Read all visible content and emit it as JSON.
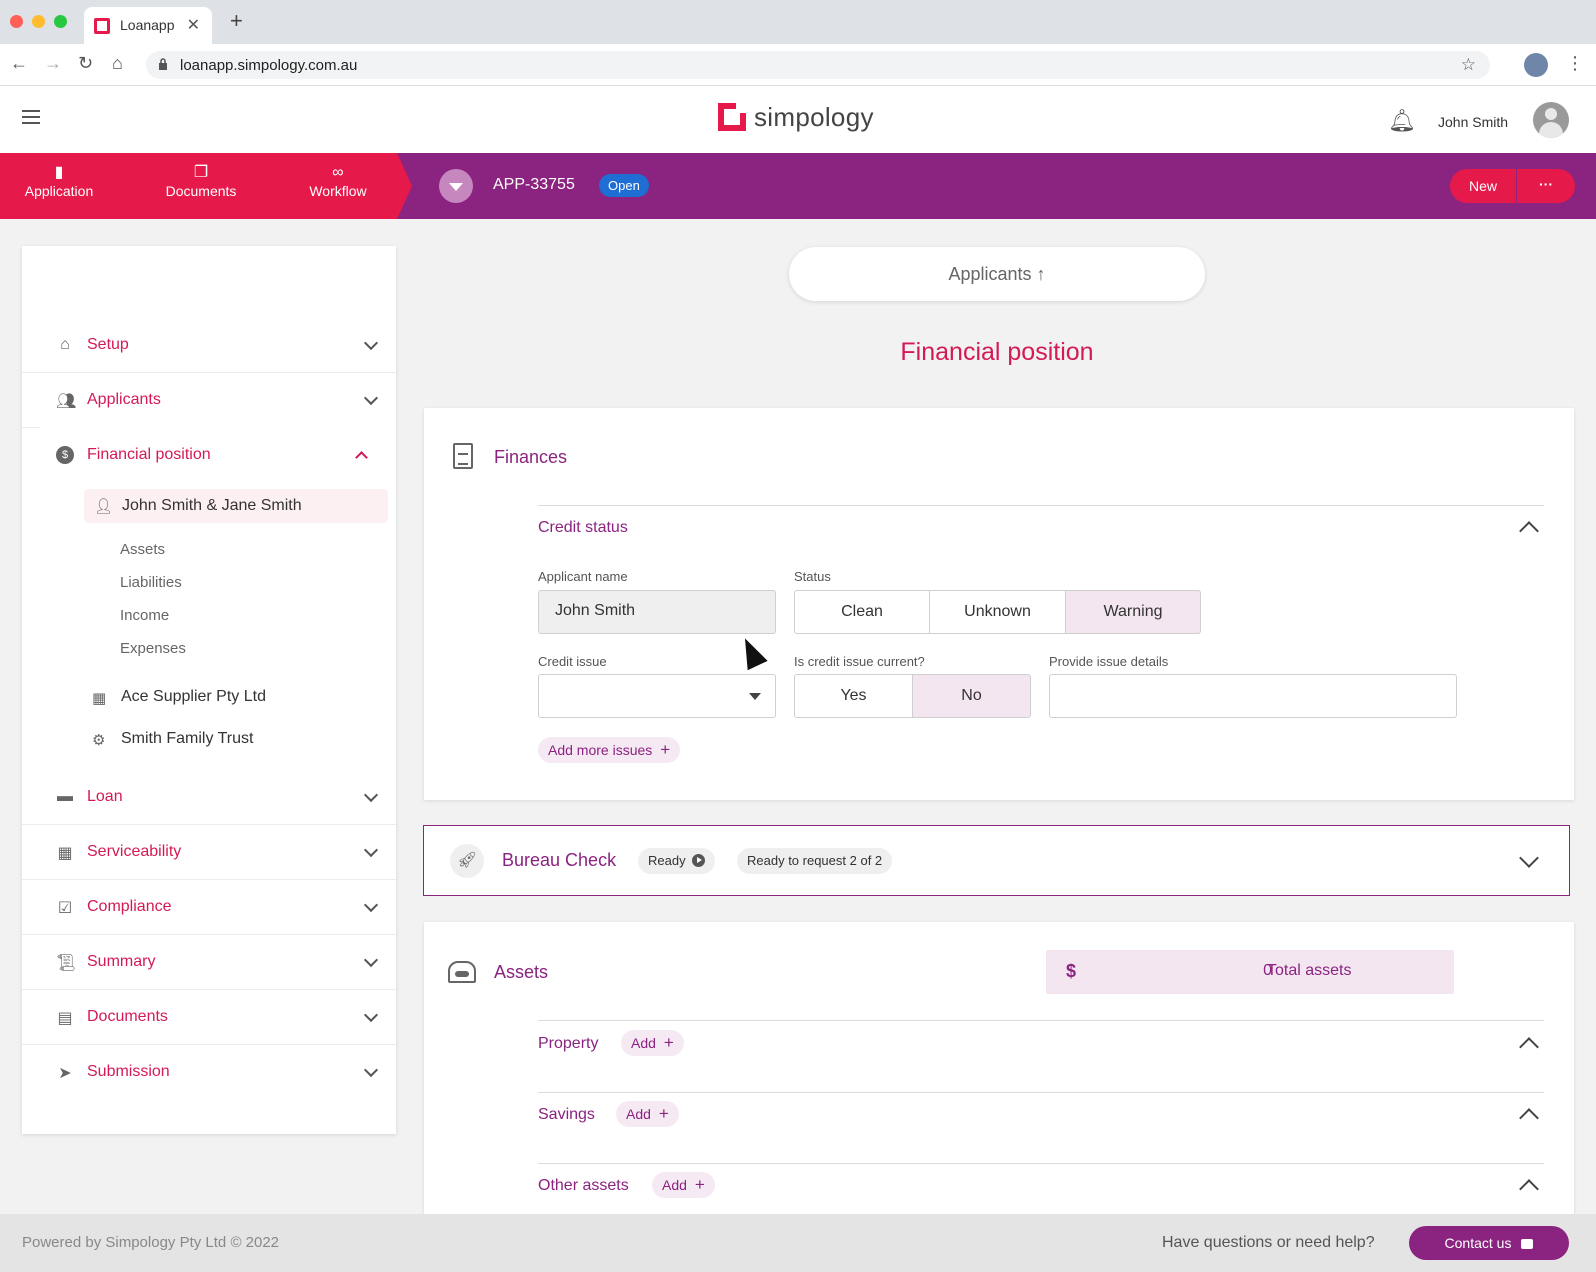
{
  "browser": {
    "tab_title": "Loanapp",
    "tab_close": "✕",
    "new_tab": "+",
    "url": "loanapp.simpology.com.au",
    "traffic_colors": [
      "#ff5f57",
      "#febc2e",
      "#28c840"
    ]
  },
  "header": {
    "logo_text": "simpology",
    "user_name": "John Smith"
  },
  "navbar": {
    "items": [
      {
        "label": "Application",
        "icon": "clipboard-icon"
      },
      {
        "label": "Documents",
        "icon": "copy-icon"
      },
      {
        "label": "Workflow",
        "icon": "infinity-icon"
      }
    ],
    "app_id": "APP-33755",
    "status": "Open",
    "new_label": "New",
    "more_label": "···",
    "colors": {
      "accent": "#e5194a",
      "brand": "#8b2380",
      "status": "#1e6ed4"
    }
  },
  "sidebar": {
    "sections": [
      {
        "label": "Setup",
        "icon": "home-icon"
      },
      {
        "label": "Applicants",
        "icon": "users-icon"
      },
      {
        "label": "Financial position",
        "icon": "dollar-circle-icon",
        "expanded": true
      },
      {
        "label": "Loan",
        "icon": "wallet-icon"
      },
      {
        "label": "Serviceability",
        "icon": "grid-icon"
      },
      {
        "label": "Compliance",
        "icon": "clipboard-check-icon"
      },
      {
        "label": "Summary",
        "icon": "scroll-icon"
      },
      {
        "label": "Documents",
        "icon": "file-icon"
      },
      {
        "label": "Submission",
        "icon": "paper-plane-icon"
      }
    ],
    "financial_position": {
      "person": "John Smith & Jane Smith",
      "sub_items": [
        "Assets",
        "Liabilities",
        "Income",
        "Expenses"
      ],
      "entities": [
        {
          "label": "Ace Supplier Pty Ltd",
          "icon": "building-icon"
        },
        {
          "label": "Smith Family Trust",
          "icon": "trust-icon"
        }
      ]
    }
  },
  "main": {
    "applicants_pill": "Applicants ↑",
    "page_title": "Financial position",
    "finances": {
      "title": "Finances",
      "credit_status": {
        "title": "Credit status",
        "applicant_name_label": "Applicant name",
        "applicant_name_value": "John Smith",
        "status_label": "Status",
        "status_options": [
          "Clean",
          "Unknown",
          "Warning"
        ],
        "status_selected": "Warning",
        "credit_issue_label": "Credit issue",
        "credit_issue_value": "",
        "current_label": "Is credit issue current?",
        "current_options": [
          "Yes",
          "No"
        ],
        "current_selected": "No",
        "details_label": "Provide issue details",
        "details_value": "",
        "add_more_label": "Add more issues"
      }
    },
    "bureau": {
      "title": "Bureau Check",
      "ready_label": "Ready",
      "request_label": "Ready to request 2 of 2"
    },
    "assets": {
      "title": "Assets",
      "currency": "$",
      "total_value": "0",
      "total_label": "Total assets",
      "groups": [
        {
          "label": "Property",
          "add": "Add"
        },
        {
          "label": "Savings",
          "add": "Add"
        },
        {
          "label": "Other assets",
          "add": "Add"
        }
      ]
    }
  },
  "footer": {
    "powered_by": "Powered by Simpology Pty Ltd © 2022",
    "help": "Have questions or need help?",
    "contact": "Contact us"
  }
}
